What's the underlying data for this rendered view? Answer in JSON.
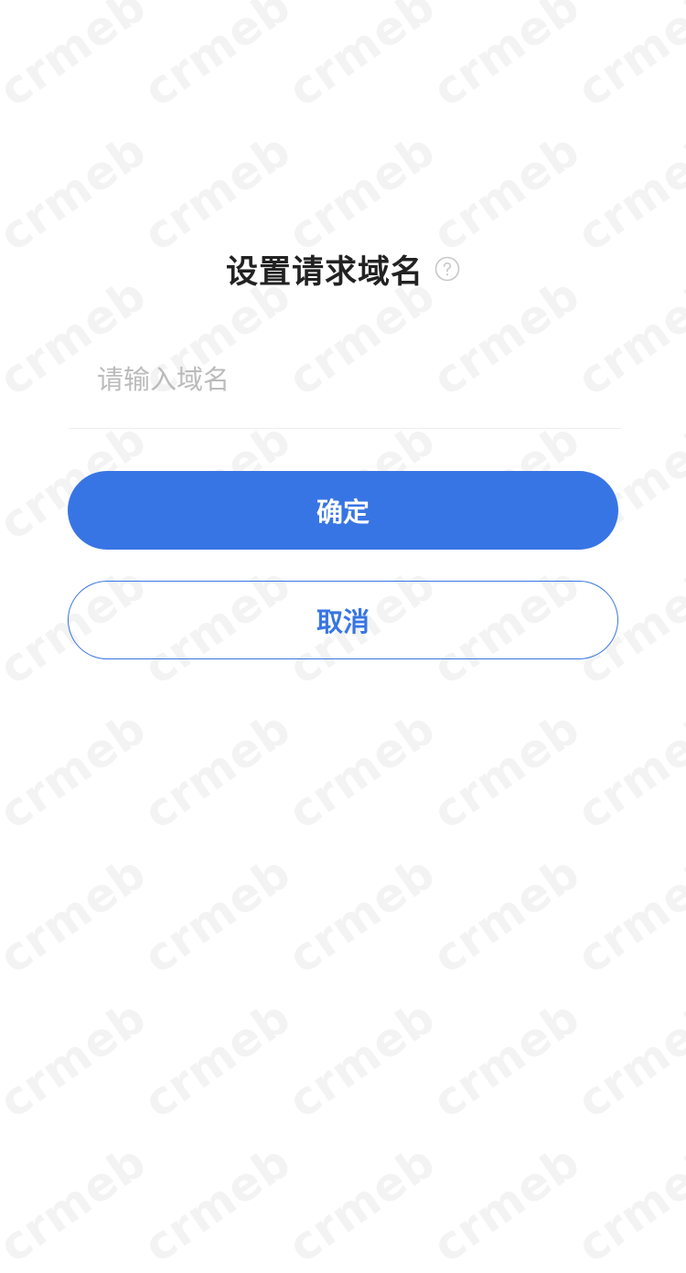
{
  "watermark": {
    "text": "crmeb"
  },
  "dialog": {
    "title": "设置请求域名",
    "help_icon": "question-circle-icon",
    "input": {
      "value": "",
      "placeholder": "请输入域名"
    },
    "confirm_label": "确定",
    "cancel_label": "取消"
  },
  "colors": {
    "primary": "#3875e4",
    "title_text": "#222222",
    "placeholder": "#bbbbbb",
    "divider": "#eeeeee",
    "help_icon": "#c8c8c8",
    "background": "#ffffff"
  }
}
